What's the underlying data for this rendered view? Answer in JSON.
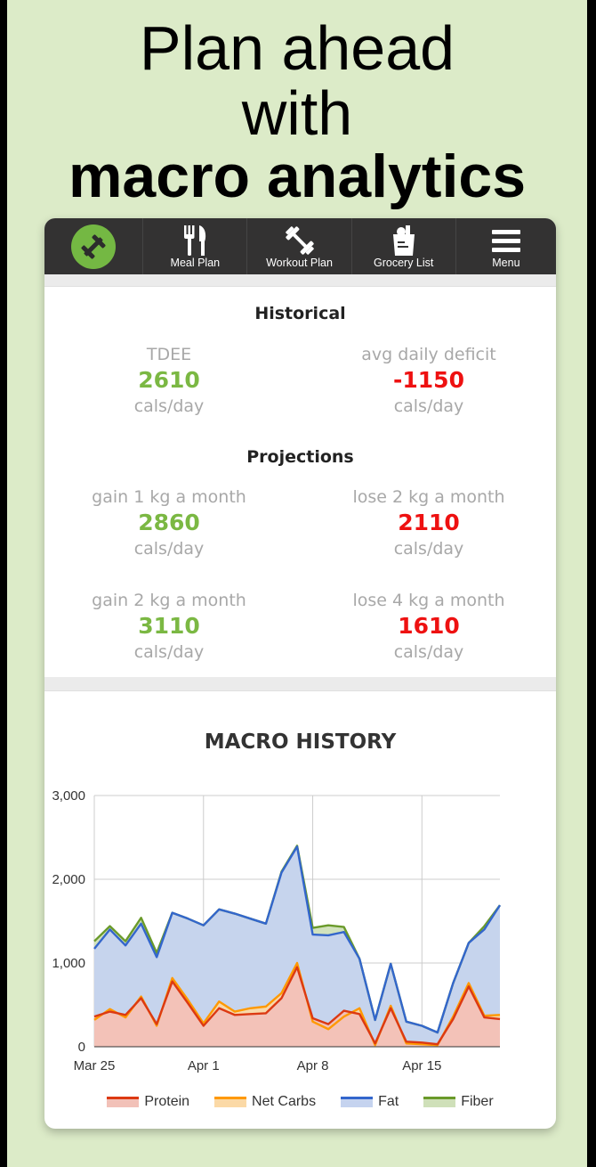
{
  "headline": {
    "line1": "Plan ahead",
    "line2": "with",
    "line3": "macro analytics"
  },
  "nav": {
    "items": [
      {
        "label": "Meal Plan",
        "icon": "fork-knife-icon"
      },
      {
        "label": "Workout Plan",
        "icon": "dumbbell-icon"
      },
      {
        "label": "Grocery List",
        "icon": "grocery-bag-icon"
      },
      {
        "label": "Menu",
        "icon": "hamburger-icon"
      }
    ],
    "logo_color": "#74b843"
  },
  "historical": {
    "title": "Historical",
    "tdee": {
      "label": "TDEE",
      "value": "2610",
      "unit": "cals/day"
    },
    "deficit": {
      "label": "avg daily deficit",
      "value": "-1150",
      "unit": "cals/day"
    }
  },
  "projections": {
    "title": "Projections",
    "items": [
      {
        "label": "gain 1 kg a month",
        "value": "2860",
        "unit": "cals/day"
      },
      {
        "label": "lose 2 kg a month",
        "value": "2110",
        "unit": "cals/day"
      },
      {
        "label": "gain 2 kg a month",
        "value": "3110",
        "unit": "cals/day"
      },
      {
        "label": "lose 4 kg a month",
        "value": "1610",
        "unit": "cals/day"
      }
    ]
  },
  "colors": {
    "positive": "#7bb843",
    "negative": "#ee1111"
  },
  "chart_data": {
    "type": "area",
    "title": "MACRO HISTORY",
    "ylim": [
      0,
      3000
    ],
    "yticks": [
      "0",
      "1,000",
      "2,000",
      "3,000"
    ],
    "xticks": [
      {
        "label": "Mar 25",
        "x": 0
      },
      {
        "label": "Apr 1",
        "x": 7
      },
      {
        "label": "Apr 8",
        "x": 14
      },
      {
        "label": "Apr 15",
        "x": 21
      }
    ],
    "x": [
      0,
      1,
      2,
      3,
      4,
      5,
      6,
      7,
      8,
      9,
      10,
      11,
      12,
      13,
      14,
      15,
      16,
      17,
      18,
      19,
      20,
      21,
      22,
      23,
      24,
      25,
      26
    ],
    "series": [
      {
        "name": "Protein",
        "color": "#dc3912",
        "fill": "#f2c1b8",
        "values": [
          360,
          420,
          380,
          580,
          270,
          780,
          520,
          250,
          460,
          380,
          390,
          400,
          580,
          950,
          340,
          270,
          430,
          390,
          40,
          460,
          60,
          50,
          30,
          330,
          720,
          350,
          330
        ]
      },
      {
        "name": "Net Carbs",
        "color": "#ff9900",
        "fill": "#fbd9a6",
        "values": [
          320,
          450,
          350,
          600,
          250,
          820,
          560,
          280,
          540,
          420,
          460,
          480,
          640,
          1000,
          300,
          210,
          360,
          460,
          20,
          490,
          40,
          30,
          20,
          360,
          760,
          370,
          380
        ]
      },
      {
        "name": "Fat",
        "color": "#3366cc",
        "fill": "#c5d3ef",
        "values": [
          1170,
          1400,
          1210,
          1470,
          1070,
          1600,
          1530,
          1450,
          1640,
          1590,
          1530,
          1470,
          2080,
          2390,
          1340,
          1330,
          1370,
          1050,
          320,
          990,
          300,
          250,
          170,
          760,
          1240,
          1400,
          1690
        ]
      },
      {
        "name": "Fiber",
        "color": "#6a9a2a",
        "fill": "#cfe0b9",
        "values": [
          1260,
          1440,
          1260,
          1540,
          1120,
          1600,
          1530,
          1450,
          1640,
          1590,
          1530,
          1470,
          2090,
          2400,
          1420,
          1450,
          1430,
          1050,
          320,
          990,
          300,
          250,
          170,
          760,
          1240,
          1440,
          1690
        ]
      }
    ],
    "legend": "bottom",
    "grid": true
  }
}
